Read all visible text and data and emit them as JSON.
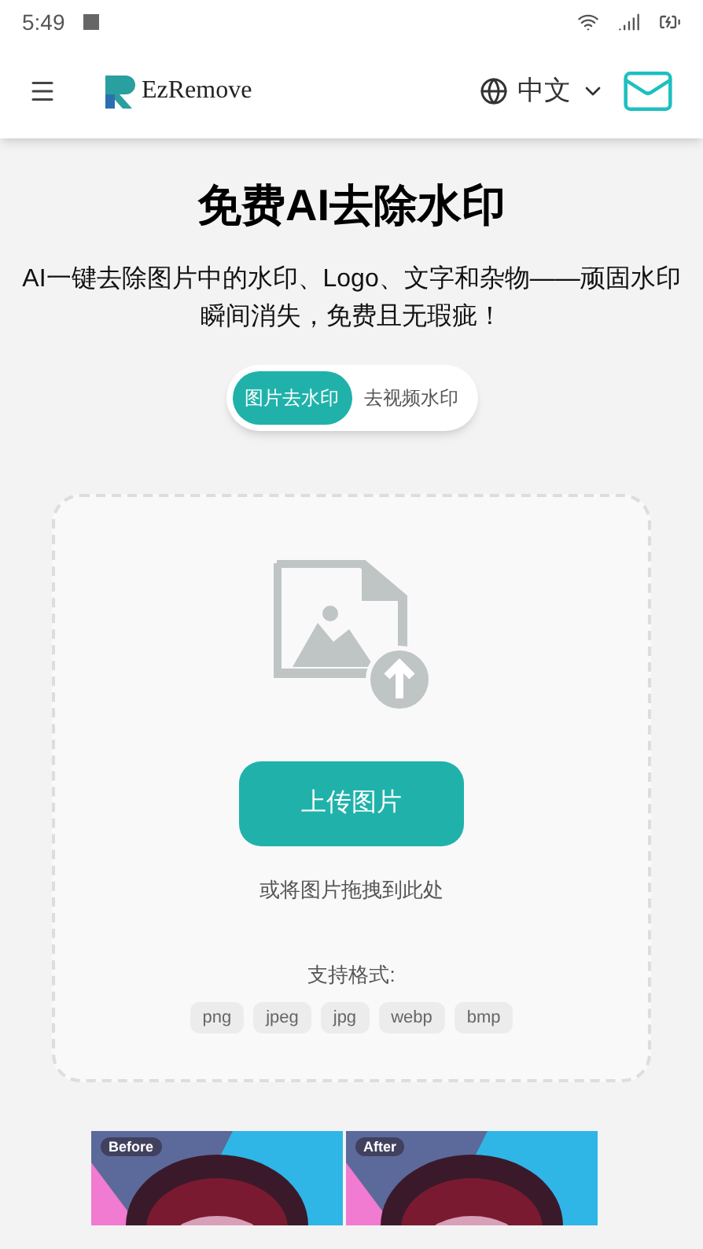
{
  "status_bar": {
    "time": "5:49"
  },
  "header": {
    "brand": "EzRemove",
    "language": "中文"
  },
  "hero": {
    "title": "免费AI去除水印",
    "description": "AI一键去除图片中的水印、Logo、文字和杂物——顽固水印瞬间消失，免费且无瑕疵！"
  },
  "tabs": [
    {
      "label": "图片去水印",
      "selected": true
    },
    {
      "label": "去视频水印",
      "selected": false
    }
  ],
  "upload": {
    "button": "上传图片",
    "hint": "或将图片拖拽到此处",
    "formats_label": "支持格式:",
    "formats": [
      "png",
      "jpeg",
      "jpg",
      "webp",
      "bmp"
    ]
  },
  "examples": [
    {
      "kind": "picture",
      "label": "Before"
    },
    {
      "kind": "picture",
      "label": "After"
    }
  ]
}
